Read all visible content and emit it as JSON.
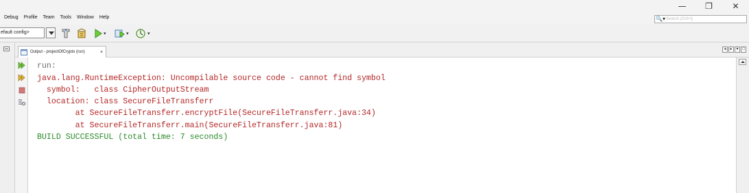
{
  "menu": [
    "Debug",
    "Profile",
    "Team",
    "Tools",
    "Window",
    "Help"
  ],
  "window_controls": {
    "minimize": "—",
    "restore": "❐",
    "close": "✕"
  },
  "search": {
    "placeholder": "Search (Ctrl+I)",
    "icon": "search-icon"
  },
  "toolbar": {
    "config": "efault config>"
  },
  "tab": {
    "title": "Output - projectOfCrypto (run)",
    "close": "×"
  },
  "output": {
    "lines": [
      "run:",
      "java.lang.RuntimeException: Uncompilable source code - cannot find symbol",
      "  symbol:   class CipherOutputStream",
      "  location: class SecureFileTransferr",
      "        at SecureFileTransferr.encryptFile(SecureFileTransferr.java:34)",
      "        at SecureFileTransferr.main(SecureFileTransferr.java:81)",
      "BUILD SUCCESSFUL (total time: 7 seconds)"
    ]
  },
  "colors": {
    "error": "#b32626",
    "success": "#2a8a2a",
    "run": "#6e6e6e"
  }
}
